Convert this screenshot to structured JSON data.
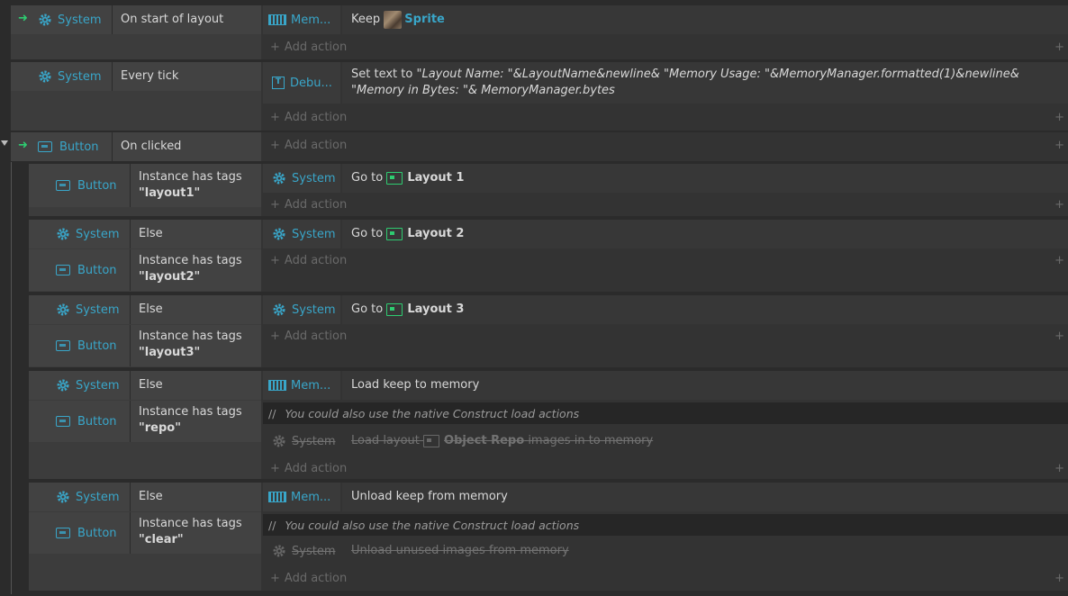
{
  "events": {
    "e1": {
      "cond_obj": "System",
      "cond_text": "On start of layout",
      "act_obj": "Mem...",
      "act_keep": "Keep",
      "act_sprite": "Sprite",
      "add_action": "Add action"
    },
    "e2": {
      "cond_obj": "System",
      "cond_text": "Every tick",
      "act_obj": "Debu...",
      "act_prefix": "Set text to",
      "act_expr": "\"Layout Name: \"&LayoutName&newline& \"Memory Usage: \"&MemoryManager.formatted(1)&newline& \"Memory in Bytes: \"& MemoryManager.bytes",
      "add_action": "Add action"
    },
    "e3": {
      "cond_obj": "Button",
      "cond_text": "On clicked",
      "add_action": "Add action"
    },
    "s1": {
      "cond_obj": "Button",
      "cond_text": "Instance has tags",
      "cond_tag": "\"layout1\"",
      "act_obj": "System",
      "act_goto": "Go to",
      "act_layout": "Layout 1",
      "add_action": "Add action"
    },
    "s2": {
      "else_obj": "System",
      "else_text": "Else",
      "cond_obj": "Button",
      "cond_text": "Instance has tags",
      "cond_tag": "\"layout2\"",
      "act_obj": "System",
      "act_goto": "Go to",
      "act_layout": "Layout 2",
      "add_action": "Add action"
    },
    "s3": {
      "else_obj": "System",
      "else_text": "Else",
      "cond_obj": "Button",
      "cond_text": "Instance has tags",
      "cond_tag": "\"layout3\"",
      "act_obj": "System",
      "act_goto": "Go to",
      "act_layout": "Layout 3",
      "add_action": "Add action"
    },
    "s4": {
      "else_obj": "System",
      "else_text": "Else",
      "cond_obj": "Button",
      "cond_text": "Instance has tags",
      "cond_tag": "\"repo\"",
      "act_obj": "Mem...",
      "act_text": "Load keep to memory",
      "comment": "You could also use the native Construct load actions",
      "dis_obj": "System",
      "dis_prefix": "Load layout",
      "dis_layout": "Object Repo",
      "dis_suffix": "images in to memory",
      "add_action": "Add action"
    },
    "s5": {
      "else_obj": "System",
      "else_text": "Else",
      "cond_obj": "Button",
      "cond_text": "Instance has tags",
      "cond_tag": "\"clear\"",
      "act_obj": "Mem...",
      "act_text": "Unload keep from memory",
      "comment": "You could also use the native Construct load actions",
      "dis_obj": "System",
      "dis_text": "Unload unused images from memory",
      "add_action": "Add action"
    }
  },
  "icons": {
    "trigger": "green-arrow-icon",
    "system": "gear-icon",
    "button": "button-icon",
    "memory": "memory-icon",
    "text": "text-icon",
    "layout": "layout-icon",
    "comment": "comment-icon"
  },
  "colors": {
    "object_label": "#39a6c9",
    "trigger_arrow": "#2ecc71",
    "layout_icon": "#2ecc71",
    "background": "#2b2b2b"
  }
}
